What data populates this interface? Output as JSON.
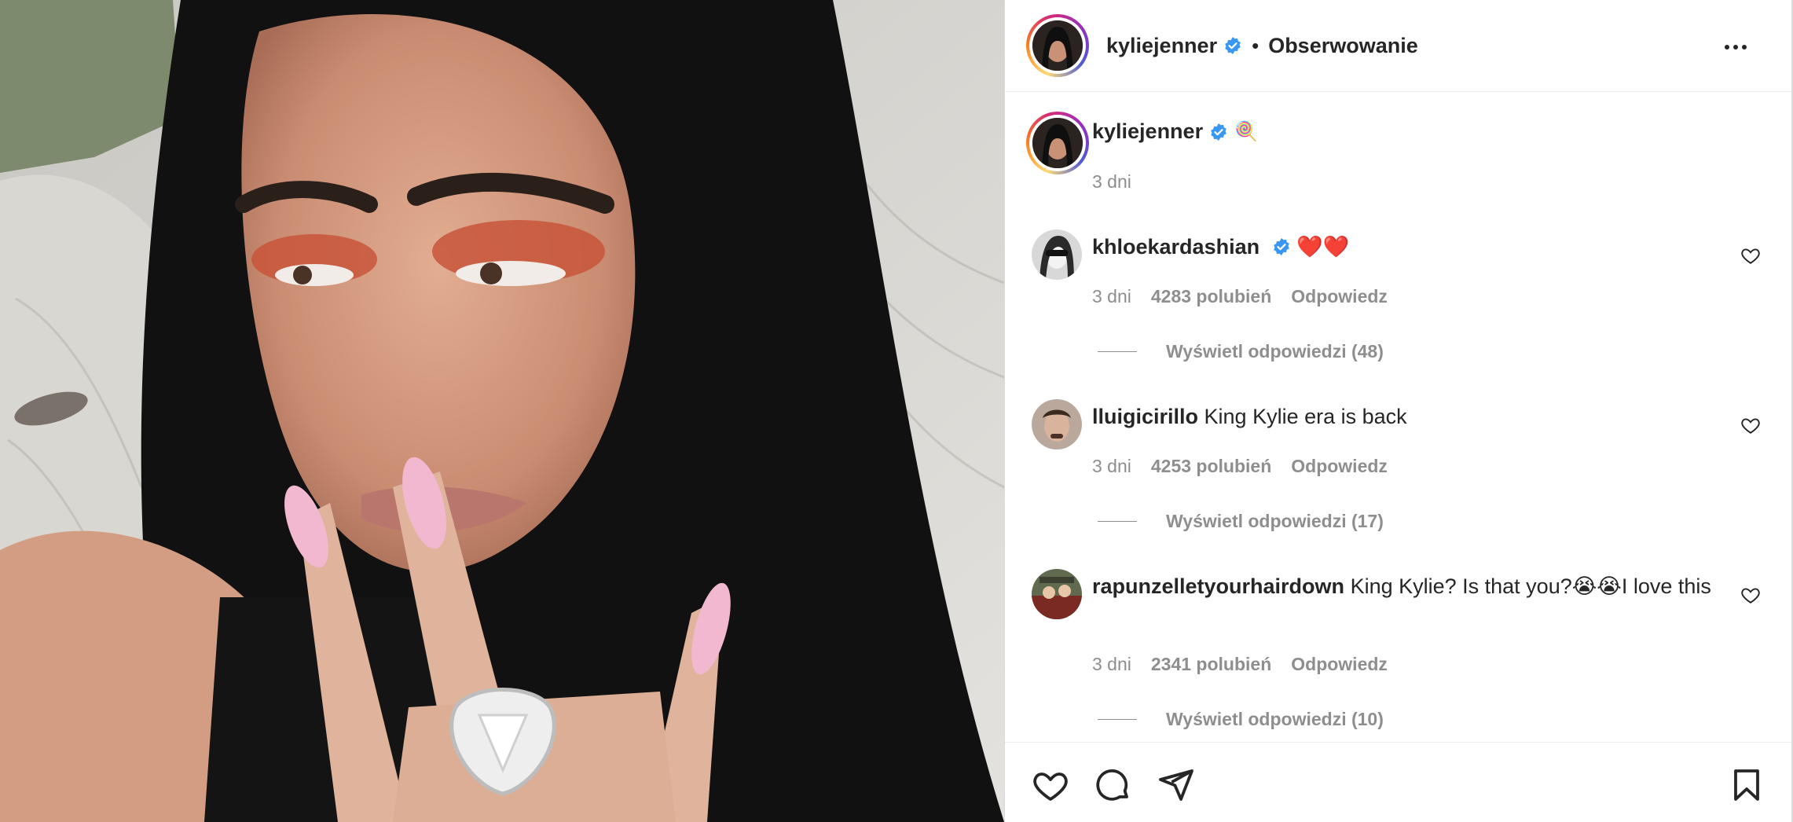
{
  "post": {
    "author": "kyliejenner",
    "follow_status": "Obserwowanie",
    "separator": "•",
    "more_options_icon": "more-horizontal-icon",
    "caption": {
      "username": "kyliejenner",
      "emoji": "🍭",
      "time": "3 dni"
    }
  },
  "comments": [
    {
      "username": "khloekardashian",
      "verified": true,
      "text": "❤️❤️",
      "time": "3 dni",
      "likes": "4283 polubień",
      "reply_label": "Odpowiedz",
      "view_replies": "Wyświetl odpowiedzi (48)"
    },
    {
      "username": "lluigicirillo",
      "verified": false,
      "text": "King Kylie era is back",
      "time": "3 dni",
      "likes": "4253 polubień",
      "reply_label": "Odpowiedz",
      "view_replies": "Wyświetl odpowiedzi (17)"
    },
    {
      "username": "rapunzelletyourhairdown",
      "verified": false,
      "text": "King Kylie? Is that you?😭😭I love this",
      "time": "3 dni",
      "likes": "2341 polubień",
      "reply_label": "Odpowiedz",
      "view_replies": "Wyświetl odpowiedzi (10)"
    }
  ],
  "actions": {
    "like_icon": "heart-icon",
    "comment_icon": "comment-bubble-icon",
    "share_icon": "paper-plane-icon",
    "save_icon": "bookmark-icon"
  },
  "colors": {
    "text": "#262626",
    "secondary": "#8e8e8e",
    "verified_blue": "#3897f0",
    "divider": "#efefef"
  }
}
